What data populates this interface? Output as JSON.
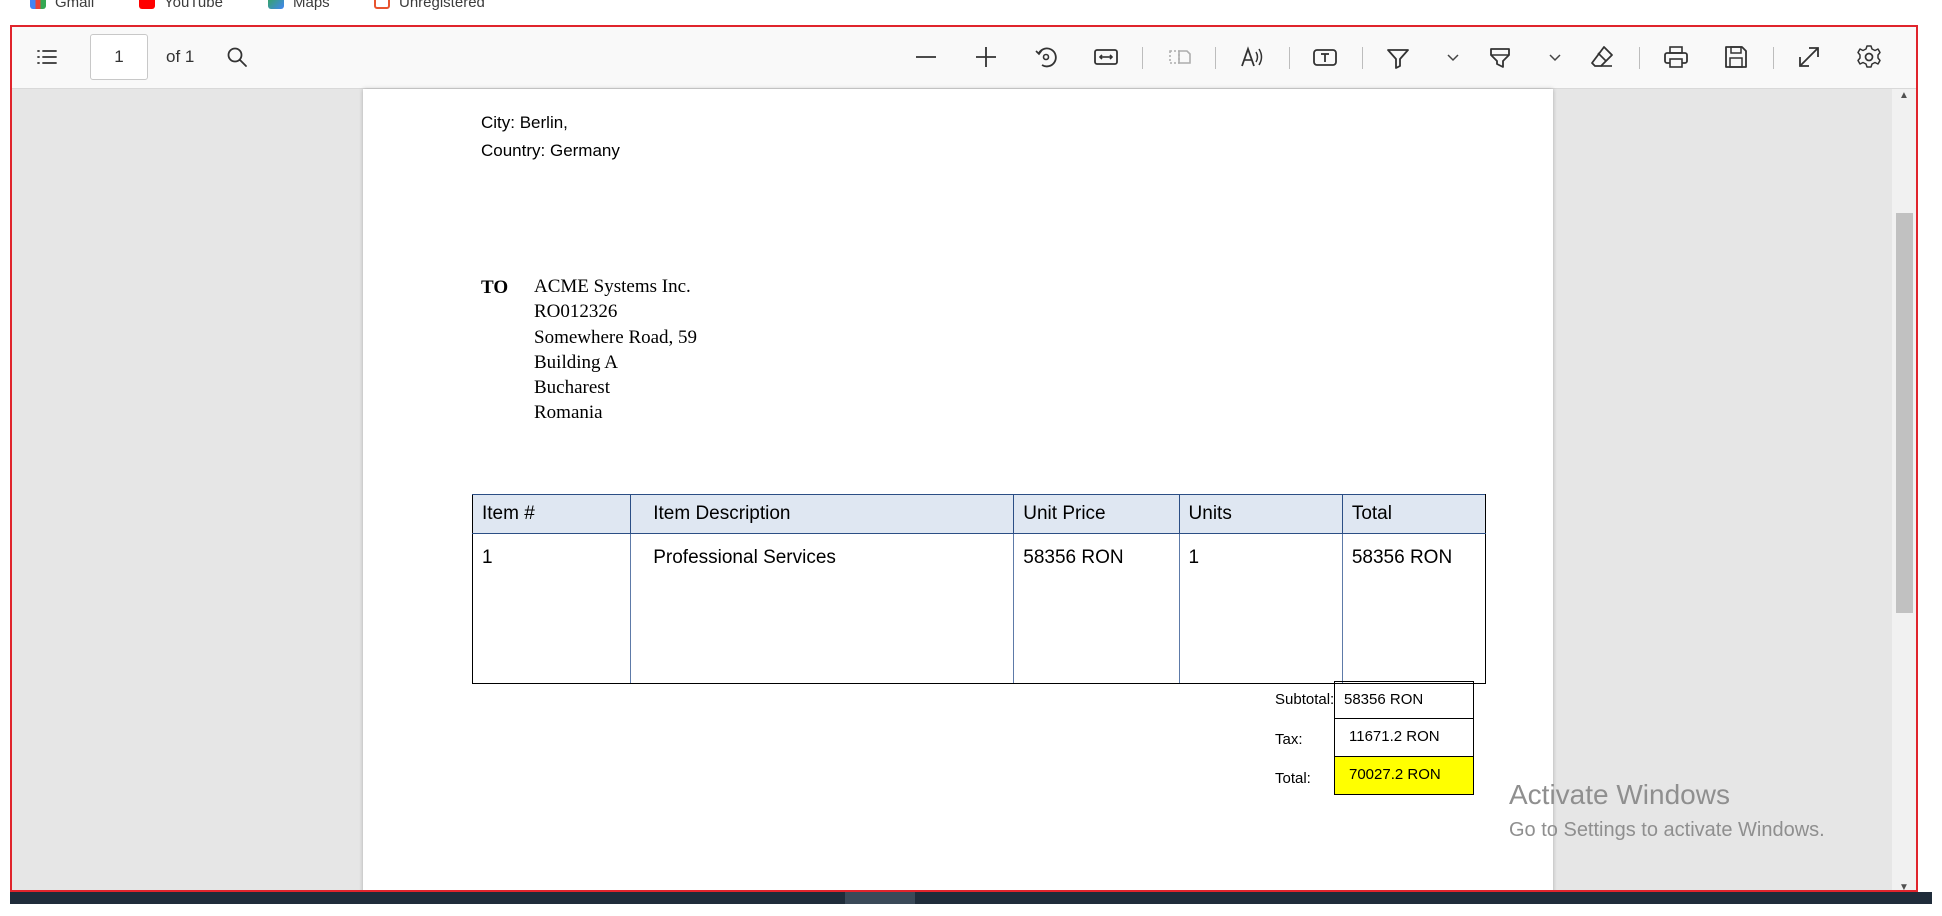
{
  "bookmarks": [
    {
      "label": "Gmail",
      "icon": "gmail-icon",
      "color": "#4285f4"
    },
    {
      "label": "YouTube",
      "icon": "youtube-icon",
      "color": "#ff0000"
    },
    {
      "label": "Maps",
      "icon": "maps-icon",
      "color": "#34a853"
    },
    {
      "label": "Unregistered",
      "icon": "unregistered-icon",
      "color": "#e8542f"
    }
  ],
  "toolbar": {
    "page_number": "1",
    "page_of": "of 1",
    "icons": [
      "contents-icon",
      "search-icon",
      "zoom-out-icon",
      "zoom-in-icon",
      "rotate-icon",
      "fit-width-icon",
      "page-view-icon",
      "read-aloud-icon",
      "text-box-icon",
      "draw-icon",
      "chevron-down-icon",
      "highlight-icon",
      "chevron-down-icon",
      "eraser-icon",
      "print-icon",
      "save-icon",
      "fullscreen-icon",
      "settings-icon"
    ]
  },
  "document": {
    "city": "City: Berlin,",
    "country": "Country: Germany",
    "to_label": "TO",
    "to_lines": [
      "ACME Systems Inc.",
      "RO012326",
      "Somewhere Road, 59",
      "Building A",
      "Bucharest",
      "Romania"
    ],
    "table": {
      "headers": [
        "Item #",
        "Item Description",
        "Unit Price",
        "Units",
        "Total"
      ],
      "rows": [
        [
          "1",
          "Professional Services",
          "58356 RON",
          "1",
          "58356 RON"
        ]
      ]
    },
    "summary": {
      "subtotal_label": "Subtotal:",
      "subtotal_value": "58356 RON",
      "tax_label": "Tax:",
      "tax_value": "11671.2 RON",
      "total_label": "Total:",
      "total_value": "70027.2 RON",
      "total_highlight": "#ffff00"
    }
  },
  "watermark": {
    "title": "Activate Windows",
    "subtitle": "Go to Settings to activate Windows."
  },
  "colors": {
    "frame_border": "#e0242c",
    "table_header_bg": "#dfe7f2"
  }
}
